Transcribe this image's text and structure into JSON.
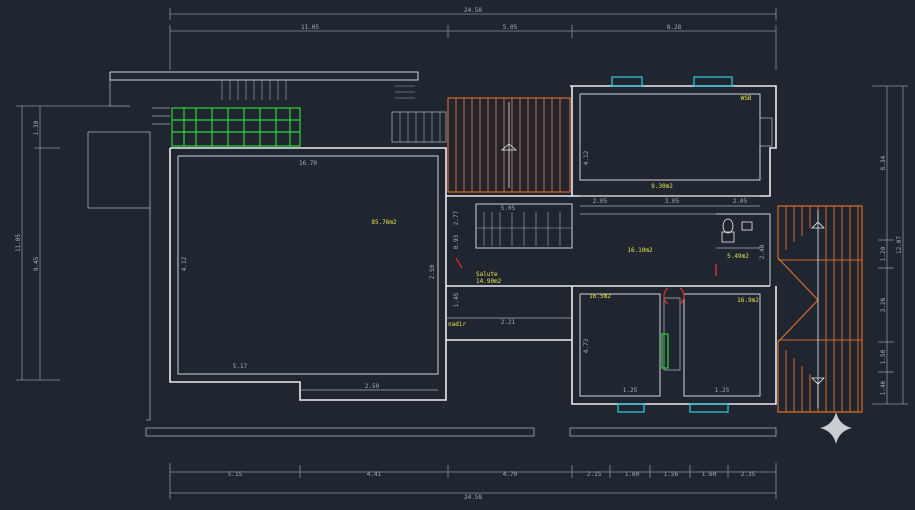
{
  "colors": {
    "background": "#1f2630",
    "walls": "#e9ecef",
    "dimensions": "#a7adb4",
    "area_labels": "#e8e34a",
    "roof_hatch": "#d86a2a",
    "pergola": "#2fd33a",
    "windows": "#2fc3d8",
    "door_marks": "#e03030"
  },
  "dimensions": {
    "top_total": "24.58",
    "top_segments": [
      "11.05",
      "5.05",
      "8.28"
    ],
    "bottom_total": "24.58",
    "bottom_segments": [
      "5.15",
      "4.41",
      "4.70",
      "2.15",
      "1.60",
      "1.56",
      "1.60",
      "2.35"
    ],
    "left_outer": "11.05",
    "left_inner": "9.45",
    "left_top": "1.30",
    "right_outer": "12.07",
    "right_segments": [
      "6.34",
      "1.20",
      "3.26",
      "1.50",
      "1.46"
    ],
    "room_inner": [
      "16.70",
      "5.05",
      "5.17",
      "2.50",
      "2.21",
      "4.12",
      "2.05",
      "3.05",
      "2.05",
      "2.40",
      "4.73",
      "1.25",
      "2.50",
      "2.77",
      "0.93",
      "1.45"
    ]
  },
  "rooms": {
    "big_hall": "85.76m2",
    "top_right": "9.30m2",
    "center": "16.10m2",
    "bath": "5.49m2",
    "salute": "Salute",
    "salute_area": "14.90m2",
    "bottom_left": "16.5m2",
    "bottom_right": "16.9m2",
    "corner_tag": "WSB",
    "small_tag": "nadir"
  },
  "icons": {
    "sparkle": "four-point-star-icon"
  }
}
